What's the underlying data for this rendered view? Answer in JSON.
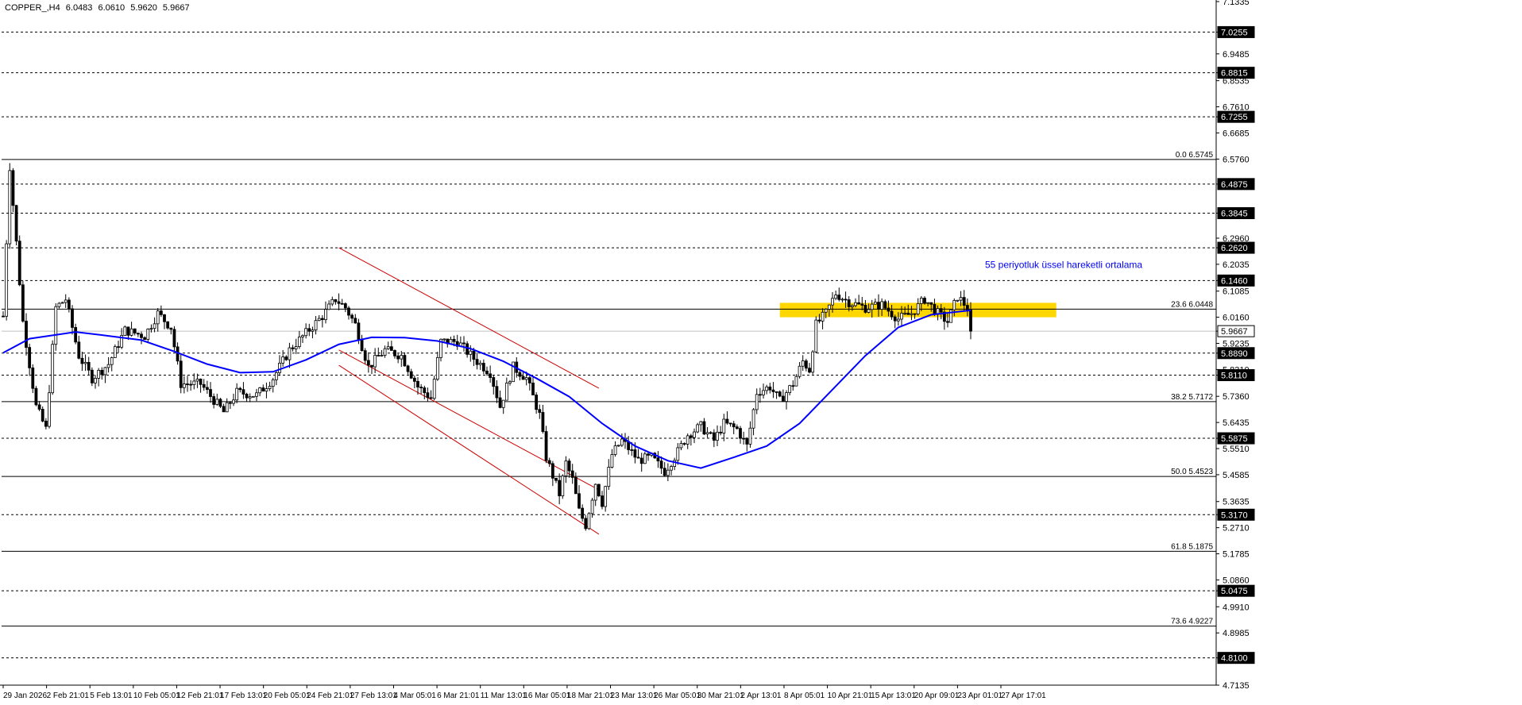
{
  "header": {
    "symbol": "COPPER_,H4",
    "open": "6.0483",
    "high": "6.0610",
    "low": "5.9620",
    "close": "5.9667"
  },
  "annotation": {
    "text": "55 periyotluk üssel hareketli ortalama",
    "color": "#0000ff"
  },
  "colors": {
    "candle": "#000000",
    "ema": "#0000ff",
    "channel": "#cc0000",
    "zone": "#ffd700",
    "grid": "#000000"
  },
  "chart_data": {
    "type": "candlestick",
    "timeframe": "H4",
    "y_axis": {
      "min": 4.7135,
      "max": 7.1335,
      "ticks": [
        "7.1335",
        "7.0255",
        "6.9485",
        "6.8815",
        "6.8535",
        "6.7610",
        "6.7255",
        "6.6685",
        "6.5760",
        "6.4875",
        "6.3845",
        "6.2960",
        "6.2620",
        "6.2035",
        "6.1460",
        "6.1085",
        "6.0160",
        "5.9667",
        "5.9235",
        "5.8890",
        "5.8310",
        "5.8110",
        "5.7360",
        "5.6435",
        "5.5875",
        "5.5510",
        "5.4585",
        "5.3635",
        "5.3170",
        "5.2710",
        "5.1785",
        "5.0860",
        "5.0475",
        "4.9910",
        "4.8985",
        "4.8100",
        "4.7135"
      ]
    },
    "x_labels": [
      "29 Jan 2026",
      "2 Feb 21:01",
      "5 Feb 13:01",
      "10 Feb 05:01",
      "12 Feb 21:01",
      "17 Feb 13:01",
      "20 Feb 05:01",
      "24 Feb 21:01",
      "27 Feb 13:01",
      "4 Mar 05:01",
      "6 Mar 21:01",
      "11 Mar 13:01",
      "16 Mar 05:01",
      "18 Mar 21:01",
      "23 Mar 13:01",
      "26 Mar 05:01",
      "30 Mar 21:01",
      "2 Apr 13:01",
      "8 Apr 05:01",
      "10 Apr 21:01",
      "15 Apr 13:01",
      "20 Apr 09:01",
      "23 Apr 01:01",
      "27 Apr 17:01"
    ],
    "price_levels": [
      {
        "value": 7.0255,
        "style": "dotted",
        "label": "7.0255",
        "boxed": true
      },
      {
        "value": 6.8815,
        "style": "dotted",
        "label": "6.8815",
        "boxed": true
      },
      {
        "value": 6.7255,
        "style": "dotted",
        "label": "6.7255",
        "boxed": true
      },
      {
        "value": 6.4875,
        "style": "dotted",
        "label": "6.4875",
        "boxed": true
      },
      {
        "value": 6.3845,
        "style": "dotted",
        "label": "6.3845",
        "boxed": true
      },
      {
        "value": 6.262,
        "style": "dotted",
        "label": "6.2620",
        "boxed": true
      },
      {
        "value": 6.146,
        "style": "dotted",
        "label": "6.1460",
        "boxed": true
      },
      {
        "value": 5.889,
        "style": "dotted",
        "label": "5.8890",
        "boxed": true
      },
      {
        "value": 5.811,
        "style": "dotted",
        "label": "5.8110",
        "boxed": true
      },
      {
        "value": 5.5875,
        "style": "dotted",
        "label": "5.5875",
        "boxed": true
      },
      {
        "value": 5.317,
        "style": "dotted",
        "label": "5.3170",
        "boxed": true
      },
      {
        "value": 5.0475,
        "style": "dotted",
        "label": "5.0475",
        "boxed": true
      },
      {
        "value": 4.81,
        "style": "dotted",
        "label": "4.8100",
        "boxed": true
      },
      {
        "value": 5.9667,
        "style": "current",
        "label": "5.9667",
        "boxed": true
      }
    ],
    "fibonacci": [
      {
        "ratio": "0.0",
        "value": 6.5745,
        "label": "0.0 6.5745"
      },
      {
        "ratio": "23.6",
        "value": 6.0448,
        "label": "23.6 6.0448"
      },
      {
        "ratio": "38.2",
        "value": 5.7172,
        "label": "38.2 5.7172"
      },
      {
        "ratio": "50.0",
        "value": 5.4523,
        "label": "50.0 5.4523"
      },
      {
        "ratio": "61.8",
        "value": 5.1875,
        "label": "61.8 5.1875"
      },
      {
        "ratio": "73.6",
        "value": 4.9227,
        "label": "73.6 4.9227"
      }
    ],
    "channel_lines": [
      {
        "from": {
          "bar": 102,
          "price": 6.262
        },
        "to": {
          "bar": 181,
          "price": 5.765
        }
      },
      {
        "from": {
          "bar": 102,
          "price": 5.9
        },
        "to": {
          "bar": 181,
          "price": 5.405
        }
      },
      {
        "from": {
          "bar": 102,
          "price": 5.846
        },
        "to": {
          "bar": 181,
          "price": 5.248
        }
      }
    ],
    "zone": {
      "bar_from": 236,
      "bar_to": 320,
      "price_top": 6.067,
      "price_bottom": 6.016
    },
    "ema_55": [
      {
        "bar": 0,
        "price": 5.89
      },
      {
        "bar": 8,
        "price": 5.94
      },
      {
        "bar": 22,
        "price": 5.964
      },
      {
        "bar": 32,
        "price": 5.95
      },
      {
        "bar": 42,
        "price": 5.935
      },
      {
        "bar": 52,
        "price": 5.895
      },
      {
        "bar": 62,
        "price": 5.85
      },
      {
        "bar": 72,
        "price": 5.82
      },
      {
        "bar": 82,
        "price": 5.823
      },
      {
        "bar": 92,
        "price": 5.865
      },
      {
        "bar": 102,
        "price": 5.92
      },
      {
        "bar": 112,
        "price": 5.945
      },
      {
        "bar": 122,
        "price": 5.944
      },
      {
        "bar": 132,
        "price": 5.932
      },
      {
        "bar": 142,
        "price": 5.905
      },
      {
        "bar": 152,
        "price": 5.86
      },
      {
        "bar": 162,
        "price": 5.8
      },
      {
        "bar": 172,
        "price": 5.735
      },
      {
        "bar": 182,
        "price": 5.64
      },
      {
        "bar": 192,
        "price": 5.56
      },
      {
        "bar": 202,
        "price": 5.508
      },
      {
        "bar": 212,
        "price": 5.482
      },
      {
        "bar": 222,
        "price": 5.52
      },
      {
        "bar": 232,
        "price": 5.56
      },
      {
        "bar": 242,
        "price": 5.64
      },
      {
        "bar": 252,
        "price": 5.76
      },
      {
        "bar": 262,
        "price": 5.88
      },
      {
        "bar": 272,
        "price": 5.98
      },
      {
        "bar": 282,
        "price": 6.025
      },
      {
        "bar": 292,
        "price": 6.038
      },
      {
        "bar": 294,
        "price": 6.04
      }
    ],
    "ohlc_keypoints": [
      {
        "bar": 0,
        "price": 6.02
      },
      {
        "bar": 2,
        "price": 6.55
      },
      {
        "bar": 4,
        "price": 6.28
      },
      {
        "bar": 6,
        "price": 6.0
      },
      {
        "bar": 10,
        "price": 5.7
      },
      {
        "bar": 13,
        "price": 5.62
      },
      {
        "bar": 16,
        "price": 6.05
      },
      {
        "bar": 19,
        "price": 6.08
      },
      {
        "bar": 23,
        "price": 5.88
      },
      {
        "bar": 27,
        "price": 5.8
      },
      {
        "bar": 32,
        "price": 5.85
      },
      {
        "bar": 37,
        "price": 5.97
      },
      {
        "bar": 43,
        "price": 5.95
      },
      {
        "bar": 47,
        "price": 6.03
      },
      {
        "bar": 51,
        "price": 5.98
      },
      {
        "bar": 54,
        "price": 5.78
      },
      {
        "bar": 60,
        "price": 5.78
      },
      {
        "bar": 67,
        "price": 5.68
      },
      {
        "bar": 71,
        "price": 5.75
      },
      {
        "bar": 77,
        "price": 5.74
      },
      {
        "bar": 82,
        "price": 5.8
      },
      {
        "bar": 87,
        "price": 5.9
      },
      {
        "bar": 92,
        "price": 5.96
      },
      {
        "bar": 97,
        "price": 6.02
      },
      {
        "bar": 101,
        "price": 6.08
      },
      {
        "bar": 104,
        "price": 6.05
      },
      {
        "bar": 107,
        "price": 5.99
      },
      {
        "bar": 111,
        "price": 5.84
      },
      {
        "bar": 116,
        "price": 5.9
      },
      {
        "bar": 121,
        "price": 5.88
      },
      {
        "bar": 126,
        "price": 5.77
      },
      {
        "bar": 130,
        "price": 5.73
      },
      {
        "bar": 133,
        "price": 5.93
      },
      {
        "bar": 138,
        "price": 5.93
      },
      {
        "bar": 143,
        "price": 5.87
      },
      {
        "bar": 148,
        "price": 5.82
      },
      {
        "bar": 151,
        "price": 5.7
      },
      {
        "bar": 155,
        "price": 5.84
      },
      {
        "bar": 159,
        "price": 5.8
      },
      {
        "bar": 163,
        "price": 5.67
      },
      {
        "bar": 165,
        "price": 5.52
      },
      {
        "bar": 169,
        "price": 5.39
      },
      {
        "bar": 171,
        "price": 5.5
      },
      {
        "bar": 173,
        "price": 5.44
      },
      {
        "bar": 175,
        "price": 5.33
      },
      {
        "bar": 177,
        "price": 5.28
      },
      {
        "bar": 180,
        "price": 5.43
      },
      {
        "bar": 182,
        "price": 5.36
      },
      {
        "bar": 185,
        "price": 5.53
      },
      {
        "bar": 188,
        "price": 5.58
      },
      {
        "bar": 193,
        "price": 5.51
      },
      {
        "bar": 197,
        "price": 5.52
      },
      {
        "bar": 201,
        "price": 5.47
      },
      {
        "bar": 205,
        "price": 5.54
      },
      {
        "bar": 208,
        "price": 5.6
      },
      {
        "bar": 212,
        "price": 5.63
      },
      {
        "bar": 216,
        "price": 5.58
      },
      {
        "bar": 219,
        "price": 5.64
      },
      {
        "bar": 223,
        "price": 5.62
      },
      {
        "bar": 226,
        "price": 5.56
      },
      {
        "bar": 229,
        "price": 5.75
      },
      {
        "bar": 233,
        "price": 5.77
      },
      {
        "bar": 236,
        "price": 5.72
      },
      {
        "bar": 240,
        "price": 5.78
      },
      {
        "bar": 243,
        "price": 5.86
      },
      {
        "bar": 245,
        "price": 5.83
      },
      {
        "bar": 247,
        "price": 5.99
      },
      {
        "bar": 250,
        "price": 6.03
      },
      {
        "bar": 253,
        "price": 6.1
      },
      {
        "bar": 257,
        "price": 6.07
      },
      {
        "bar": 262,
        "price": 6.05
      },
      {
        "bar": 267,
        "price": 6.06
      },
      {
        "bar": 272,
        "price": 6.01
      },
      {
        "bar": 276,
        "price": 6.03
      },
      {
        "bar": 280,
        "price": 6.08
      },
      {
        "bar": 284,
        "price": 6.03
      },
      {
        "bar": 287,
        "price": 6.0
      },
      {
        "bar": 290,
        "price": 6.09
      },
      {
        "bar": 293,
        "price": 6.05
      },
      {
        "bar": 294,
        "price": 5.9667
      }
    ]
  }
}
